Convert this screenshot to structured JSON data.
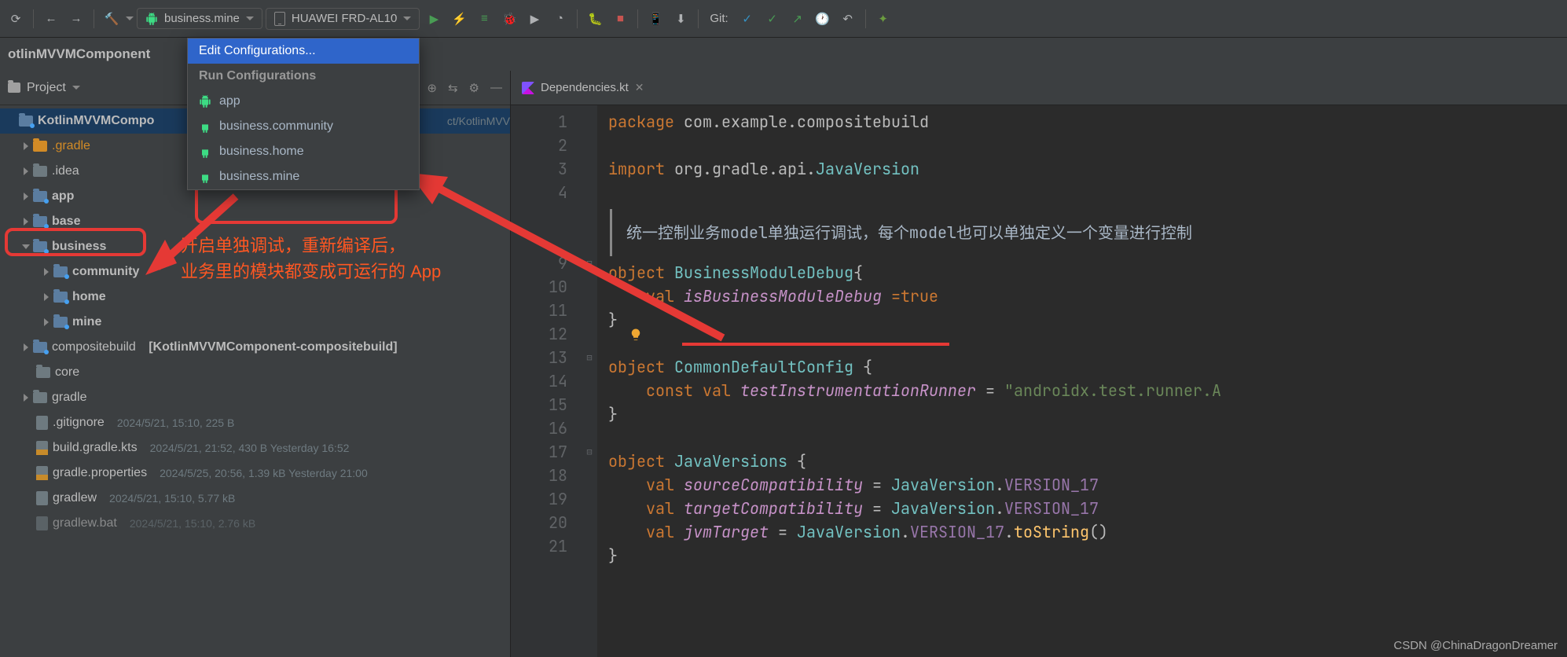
{
  "toolbar": {
    "run_config_selected": "business.mine",
    "device_selected": "HUAWEI FRD-AL10",
    "git_label": "Git:"
  },
  "breadcrumb": {
    "root": "otlinMVVMComponent"
  },
  "popup": {
    "edit": "Edit Configurations...",
    "header": "Run Configurations",
    "items": [
      "app",
      "business.community",
      "business.home",
      "business.mine"
    ]
  },
  "project": {
    "panel_title": "Project",
    "root": "KotlinMVVMCompo",
    "root_path": "ct/KotlinMVV",
    "gradle_folder": ".gradle",
    "idea_folder": ".idea",
    "app": "app",
    "base": "base",
    "business": "business",
    "community": "community",
    "home": "home",
    "mine": "mine",
    "compositebuild": "compositebuild",
    "compositebuild_suffix": "[KotlinMVVMComponent-compositebuild]",
    "core": "core",
    "gradle": "gradle",
    "gitignore": ".gitignore",
    "gitignore_meta": "2024/5/21, 15:10, 225 B",
    "build_gradle": "build.gradle.kts",
    "build_gradle_meta": "2024/5/21, 21:52, 430 B Yesterday 16:52",
    "gradle_props": "gradle.properties",
    "gradle_props_meta": "2024/5/25, 20:56, 1.39 kB Yesterday 21:00",
    "gradlew": "gradlew",
    "gradlew_meta": "2024/5/21, 15:10, 5.77 kB",
    "gradlew_bat": "gradlew.bat",
    "gradlew_bat_meta": "2024/5/21, 15:10, 2.76 kB"
  },
  "annotation": {
    "line1": "开启单独调试，重新编译后，",
    "line2": "业务里的模块都变成可运行的 App"
  },
  "editor": {
    "tab_name": "Dependencies.kt",
    "lines": {
      "1": {
        "pre": "",
        "parts": [
          {
            "t": "package ",
            "c": "kw"
          },
          {
            "t": "com",
            "c": "pkg"
          },
          {
            "t": ".",
            "c": "dot"
          },
          {
            "t": "example",
            "c": "pkg"
          },
          {
            "t": ".",
            "c": "dot"
          },
          {
            "t": "compositebuild",
            "c": "pkg"
          }
        ]
      },
      "2": {
        "pre": "",
        "parts": []
      },
      "3": {
        "pre": "",
        "parts": [
          {
            "t": "import ",
            "c": "kw"
          },
          {
            "t": "org",
            "c": "pkg"
          },
          {
            "t": ".",
            "c": "dot"
          },
          {
            "t": "gradle",
            "c": "pkg"
          },
          {
            "t": ".",
            "c": "dot"
          },
          {
            "t": "api",
            "c": "pkg"
          },
          {
            "t": ".",
            "c": "dot"
          },
          {
            "t": "JavaVersion",
            "c": "type"
          }
        ]
      },
      "4": {
        "pre": "",
        "parts": []
      },
      "comment": "统一控制业务model单独运行调试，每个model也可以单独定义一个变量进行控制",
      "9": {
        "pre": "",
        "parts": [
          {
            "t": "object ",
            "c": "kw"
          },
          {
            "t": "BusinessModuleDebug",
            "c": "type"
          },
          {
            "t": "{",
            "c": "pkg"
          }
        ]
      },
      "10": {
        "pre": "    ",
        "parts": [
          {
            "t": "val ",
            "c": "kw"
          },
          {
            "t": "isBusinessModuleDebug",
            "c": "ident"
          },
          {
            "t": " =",
            "c": "kw"
          },
          {
            "t": "true",
            "c": "bool"
          }
        ]
      },
      "11": {
        "pre": "",
        "parts": [
          {
            "t": "}",
            "c": "pkg"
          }
        ]
      },
      "12": {
        "pre": "",
        "parts": []
      },
      "13": {
        "pre": "",
        "parts": [
          {
            "t": "object ",
            "c": "kw"
          },
          {
            "t": "CommonDefaultConfig ",
            "c": "type"
          },
          {
            "t": "{",
            "c": "pkg"
          }
        ]
      },
      "14": {
        "pre": "    ",
        "parts": [
          {
            "t": "const val ",
            "c": "kw"
          },
          {
            "t": "testInstrumentationRunner",
            "c": "ident"
          },
          {
            "t": " = ",
            "c": "pkg"
          },
          {
            "t": "\"androidx.test.runner.A",
            "c": "str"
          }
        ]
      },
      "15": {
        "pre": "",
        "parts": [
          {
            "t": "}",
            "c": "pkg"
          }
        ]
      },
      "16": {
        "pre": "",
        "parts": []
      },
      "17": {
        "pre": "",
        "parts": [
          {
            "t": "object ",
            "c": "kw"
          },
          {
            "t": "JavaVersions ",
            "c": "type"
          },
          {
            "t": "{",
            "c": "pkg"
          }
        ]
      },
      "18": {
        "pre": "    ",
        "parts": [
          {
            "t": "val ",
            "c": "kw"
          },
          {
            "t": "sourceCompatibility",
            "c": "ident"
          },
          {
            "t": " = ",
            "c": "pkg"
          },
          {
            "t": "JavaVersion",
            "c": "type"
          },
          {
            "t": ".",
            "c": "dot"
          },
          {
            "t": "VERSION_17",
            "c": "val"
          }
        ]
      },
      "19": {
        "pre": "    ",
        "parts": [
          {
            "t": "val ",
            "c": "kw"
          },
          {
            "t": "targetCompatibility",
            "c": "ident"
          },
          {
            "t": " = ",
            "c": "pkg"
          },
          {
            "t": "JavaVersion",
            "c": "type"
          },
          {
            "t": ".",
            "c": "dot"
          },
          {
            "t": "VERSION_17",
            "c": "val"
          }
        ]
      },
      "20": {
        "pre": "    ",
        "parts": [
          {
            "t": "val ",
            "c": "kw"
          },
          {
            "t": "jvmTarget",
            "c": "ident"
          },
          {
            "t": " = ",
            "c": "pkg"
          },
          {
            "t": "JavaVersion",
            "c": "type"
          },
          {
            "t": ".",
            "c": "dot"
          },
          {
            "t": "VERSION_17",
            "c": "val"
          },
          {
            "t": ".",
            "c": "dot"
          },
          {
            "t": "toString",
            "c": "fn"
          },
          {
            "t": "()",
            "c": "pkg"
          }
        ]
      },
      "21": {
        "pre": "",
        "parts": [
          {
            "t": "}",
            "c": "pkg"
          }
        ]
      }
    },
    "gutter": [
      "1",
      "2",
      "3",
      "4",
      "",
      "",
      "9",
      "10",
      "11",
      "12",
      "13",
      "14",
      "15",
      "16",
      "17",
      "18",
      "19",
      "20",
      "21"
    ]
  },
  "watermark": "CSDN @ChinaDragonDreamer"
}
